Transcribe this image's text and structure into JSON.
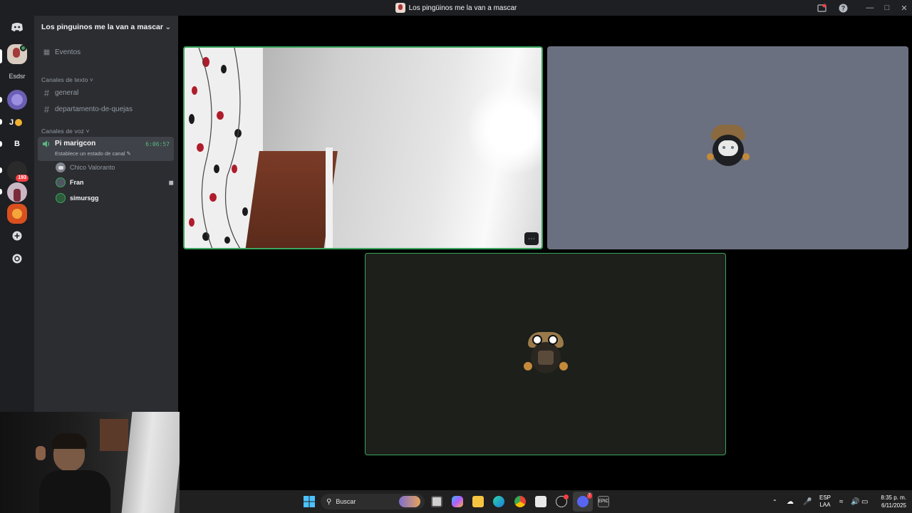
{
  "window": {
    "title": "Los pingüinos me la van a mascar",
    "controls": [
      "minimize-icon",
      "maximize-icon",
      "close-icon"
    ]
  },
  "guilds": {
    "items": [
      {
        "icon": "discord-home-icon"
      },
      {
        "label": "Esdsr"
      },
      {
        "label": "J"
      },
      {
        "label": "B"
      },
      {
        "badge": "193"
      },
      {
        "icon": "add-server-icon"
      },
      {
        "icon": "explore-icon"
      }
    ]
  },
  "server": {
    "name": "Los pinguinos me la van a mascar",
    "events_label": "Eventos",
    "text_category": "Canales de texto",
    "text_channels": [
      "general",
      "departamento-de-quejas"
    ],
    "voice_category": "Canales de voz",
    "voice_channel": {
      "name": "Pi marigcon",
      "status": "Establece un estado de canal",
      "timer": "6:06:57",
      "users": [
        {
          "name": "Chico Valoranto",
          "muted": true
        },
        {
          "name": "Fran",
          "video": true
        },
        {
          "name": "simursgg"
        }
      ]
    }
  },
  "taskbar": {
    "search_placeholder": "Buscar",
    "language_top": "ESP",
    "language_bottom": "LAA",
    "time": "8:35 p. m.",
    "date": "6/11/2025",
    "notification_badge": "7"
  },
  "colors": {
    "accent_green": "#3ba55d",
    "tile_gray": "#6b7080",
    "tile_dark": "#1c1f1a"
  }
}
